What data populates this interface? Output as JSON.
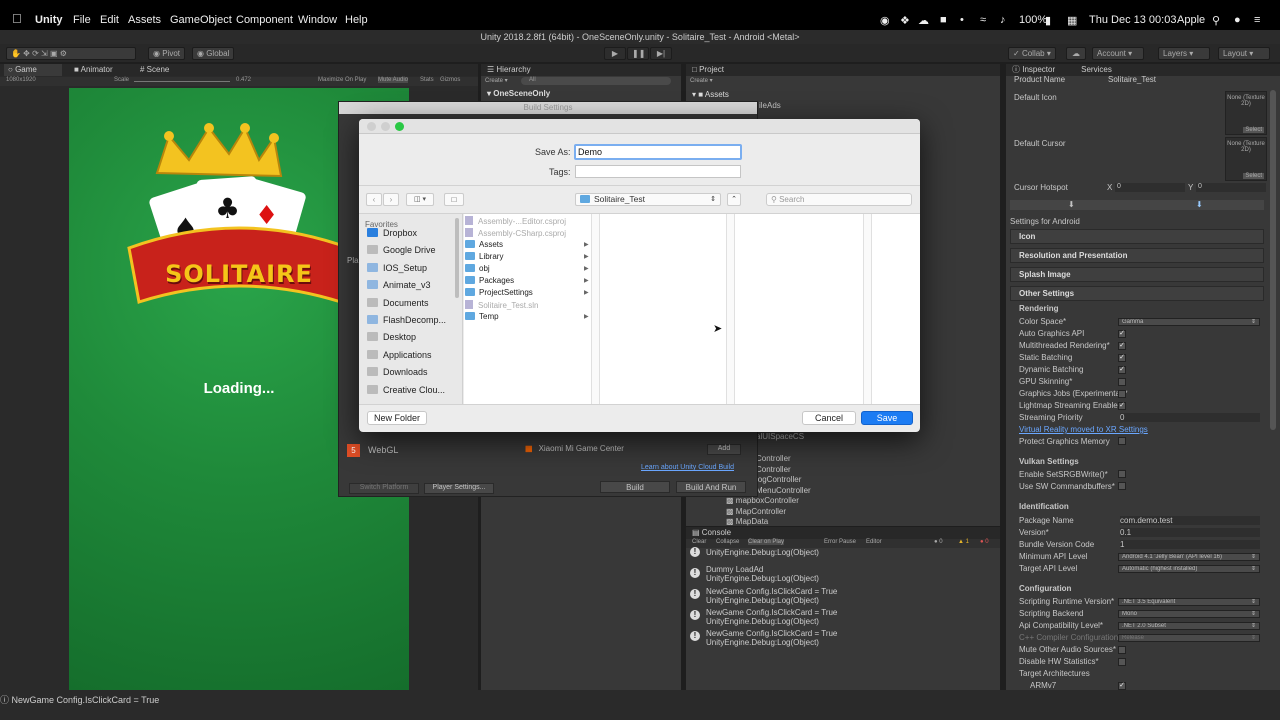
{
  "menubar": {
    "app": "Unity",
    "items": [
      "File",
      "Edit",
      "Assets",
      "GameObject",
      "Component",
      "Window",
      "Help"
    ],
    "battery": "100%",
    "clock": "Thu Dec 13  00:03",
    "user": "Apple"
  },
  "window_title": "Unity 2018.2.8f1 (64bit) - OneSceneOnly.unity - Solitaire_Test - Android <Metal>",
  "toolbar": {
    "pivot": "Pivot",
    "global": "Global",
    "collab": "Collab",
    "account": "Account",
    "layers": "Layers",
    "layout": "Layout"
  },
  "game_view": {
    "tabs": [
      "Game",
      "Animator",
      "Scene"
    ],
    "resolution": "1080x1920",
    "scale_label": "Scale",
    "scale_value": "0.472",
    "options": [
      "Maximize On Play",
      "Mute Audio",
      "Stats",
      "Gizmos"
    ],
    "logo_text": "SOLITAIRE",
    "loading": "Loading..."
  },
  "hierarchy": {
    "tab": "Hierarchy",
    "create": "Create",
    "search": "All",
    "root": "OneSceneOnly"
  },
  "project": {
    "tab": "Project",
    "create": "Create",
    "root": "Assets",
    "items": [
      "alUISpaceCS",
      "Controller",
      "Controller",
      "logController",
      "MenuController",
      "mapboxController",
      "MapController",
      "MapData"
    ],
    "partial": "ileAds"
  },
  "build_settings": {
    "title": "Build Settings",
    "platform_header": "Pla",
    "webgl": "WebGL",
    "switch_platform": "Switch Platform",
    "player_settings": "Player Settings...",
    "store": "Xiaomi Mi Game Center",
    "add": "Add",
    "learn": "Learn about Unity Cloud Build",
    "build": "Build",
    "build_run": "Build And Run"
  },
  "save_dialog": {
    "save_as_label": "Save As:",
    "save_as_value": "Demo",
    "tags_label": "Tags:",
    "location": "Solitaire_Test",
    "search_placeholder": "Search",
    "favorites_header": "Favorites",
    "favorites": [
      "Dropbox",
      "Google Drive",
      "IOS_Setup",
      "Animate_v3",
      "Documents",
      "FlashDecomp...",
      "Desktop",
      "Applications",
      "Downloads",
      "Creative Clou..."
    ],
    "files": [
      {
        "name": "Assembly-...Editor.csproj",
        "kind": "doc",
        "dim": true
      },
      {
        "name": "Assembly-CSharp.csproj",
        "kind": "doc",
        "dim": true
      },
      {
        "name": "Assets",
        "kind": "folder",
        "dim": false
      },
      {
        "name": "Library",
        "kind": "folder",
        "dim": false
      },
      {
        "name": "obj",
        "kind": "folder",
        "dim": false
      },
      {
        "name": "Packages",
        "kind": "folder",
        "dim": false
      },
      {
        "name": "ProjectSettings",
        "kind": "folder",
        "dim": false
      },
      {
        "name": "Solitaire_Test.sln",
        "kind": "doc",
        "dim": true
      },
      {
        "name": "Temp",
        "kind": "folder",
        "dim": false
      }
    ],
    "new_folder": "New Folder",
    "cancel": "Cancel",
    "save": "Save"
  },
  "console": {
    "tab": "Console",
    "buttons": [
      "Clear",
      "Collapse",
      "Clear on Play",
      "Error Pause",
      "Editor"
    ],
    "count_info": "0",
    "count_warn": "1",
    "count_err": "0",
    "entries": [
      [
        "Dummy LoadAd",
        "UnityEngine.Debug:Log(Object)"
      ],
      [
        "NewGame Config.IsClickCard = True",
        "UnityEngine.Debug:Log(Object)"
      ],
      [
        "NewGame Config.IsClickCard = True",
        "UnityEngine.Debug:Log(Object)"
      ],
      [
        "NewGame Config.IsClickCard = True",
        "UnityEngine.Debug:Log(Object)"
      ]
    ],
    "top_partial": "UnityEngine.Debug:Log(Object)"
  },
  "inspector": {
    "tabs": [
      "Inspector",
      "Services"
    ],
    "product_name_label": "Product Name",
    "product_name": "Solitaire_Test",
    "default_icon": "Default Icon",
    "default_cursor": "Default Cursor",
    "none_texture": "None (Texture 2D)",
    "select": "Select",
    "cursor_hotspot": "Cursor Hotspot",
    "x_label": "X",
    "x_val": "0",
    "y_label": "Y",
    "y_val": "0",
    "settings_for": "Settings for Android",
    "sections": [
      "Icon",
      "Resolution and Presentation",
      "Splash Image",
      "Other Settings"
    ],
    "rendering_header": "Rendering",
    "rendering": [
      {
        "label": "Color Space*",
        "type": "drop",
        "value": "Gamma"
      },
      {
        "label": "Auto Graphics API",
        "type": "chk",
        "checked": true
      },
      {
        "label": "Multithreaded Rendering*",
        "type": "chk",
        "checked": true
      },
      {
        "label": "Static Batching",
        "type": "chk",
        "checked": true
      },
      {
        "label": "Dynamic Batching",
        "type": "chk",
        "checked": true
      },
      {
        "label": "GPU Skinning*",
        "type": "chk",
        "checked": false
      },
      {
        "label": "Graphics Jobs (Experimental)*",
        "type": "chk",
        "checked": false
      },
      {
        "label": "Lightmap Streaming Enabled",
        "type": "chk",
        "checked": true
      },
      {
        "label": "Streaming Priority",
        "type": "text",
        "value": "0"
      }
    ],
    "vr_link": "Virtual Reality moved to XR Settings",
    "protect_graphics": "Protect Graphics Memory",
    "vulkan_header": "Vulkan Settings",
    "vulkan": [
      "Enable SetSRGBWrite()*",
      "Use SW Commandbuffers*"
    ],
    "identification_header": "Identification",
    "identification": [
      {
        "label": "Package Name",
        "value": "com.demo.test",
        "type": "text"
      },
      {
        "label": "Version*",
        "value": "0.1",
        "type": "text"
      },
      {
        "label": "Bundle Version Code",
        "value": "1",
        "type": "text"
      },
      {
        "label": "Minimum API Level",
        "value": "Android 4.1 'Jelly Bean' (API level 16)",
        "type": "drop"
      },
      {
        "label": "Target API Level",
        "value": "Automatic (highest installed)",
        "type": "drop"
      }
    ],
    "configuration_header": "Configuration",
    "configuration": [
      {
        "label": "Scripting Runtime Version*",
        "value": ".NET 3.5 Equivalent",
        "type": "drop"
      },
      {
        "label": "Scripting Backend",
        "value": "Mono",
        "type": "drop"
      },
      {
        "label": "Api Compatibility Level*",
        "value": ".NET 2.0 Subset",
        "type": "drop"
      },
      {
        "label": "C++ Compiler Configuration",
        "value": "Release",
        "type": "drop",
        "dim": true
      },
      {
        "label": "Mute Other Audio Sources*",
        "type": "chk",
        "checked": false
      },
      {
        "label": "Disable HW Statistics*",
        "type": "chk",
        "checked": false
      },
      {
        "label": "Target Architectures",
        "type": "none"
      },
      {
        "label": "ARMv7",
        "type": "chk",
        "checked": true
      }
    ]
  },
  "statusbar": "NewGame Config.IsClickCard = True",
  "colors": {
    "accent_blue": "#1c7cf3",
    "unity_bg": "#383838",
    "felt_green": "#1f8a3a",
    "dialog_bg": "#ececec"
  }
}
